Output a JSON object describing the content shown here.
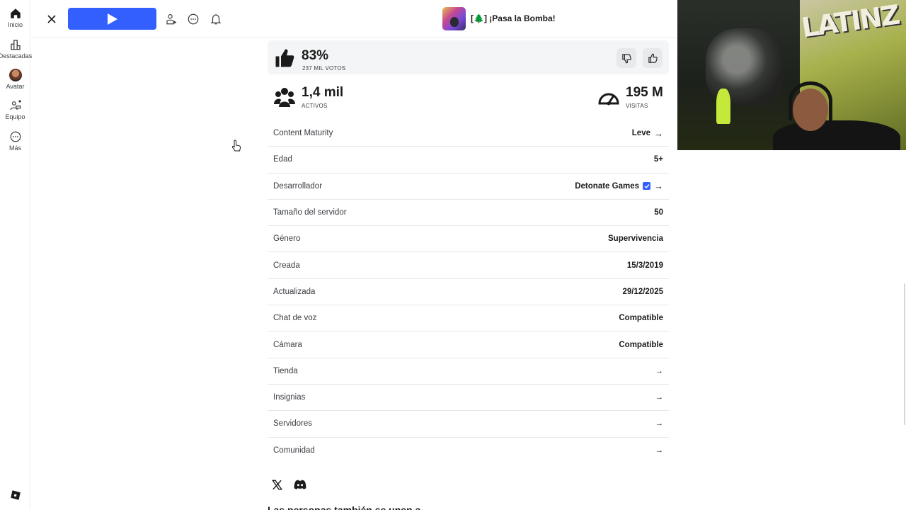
{
  "nav": {
    "items": [
      {
        "label": "Inicio",
        "icon": "home-icon"
      },
      {
        "label": "Destacadas",
        "icon": "charts-icon"
      },
      {
        "label": "Avatar",
        "icon": "avatar"
      },
      {
        "label": "Equipo",
        "icon": "party-icon"
      },
      {
        "label": "Más",
        "icon": "more-icon"
      }
    ]
  },
  "topbar": {
    "game_title": "[🌲] ¡Pasa la Bomba!",
    "play_color": "#335fff"
  },
  "rating": {
    "percent": "83%",
    "votes": "237 MIL VOTOS"
  },
  "stats": {
    "active_value": "1,4 mil",
    "active_label": "ACTIVOS",
    "visits_value": "195 M",
    "visits_label": "VISITAS"
  },
  "details": [
    {
      "key": "Content Maturity",
      "value": "Leve",
      "arrow": "→"
    },
    {
      "key": "Edad",
      "value": "5+"
    },
    {
      "key": "Desarrollador",
      "value": "Detonate Games",
      "verified": true,
      "arrow": "→"
    },
    {
      "key": "Tamaño del servidor",
      "value": "50"
    },
    {
      "key": "Género",
      "value": "Supervivencia"
    },
    {
      "key": "Creada",
      "value": "15/3/2019"
    },
    {
      "key": "Actualizada",
      "value": "29/12/2025"
    },
    {
      "key": "Chat de voz",
      "value": "Compatible"
    },
    {
      "key": "Cámara",
      "value": "Compatible"
    },
    {
      "key": "Tienda",
      "value": "",
      "arrow": "→"
    },
    {
      "key": "Insignias",
      "value": "",
      "arrow": "→"
    },
    {
      "key": "Servidores",
      "value": "",
      "arrow": "→"
    },
    {
      "key": "Comunidad",
      "value": "",
      "arrow": "→"
    }
  ],
  "socials": [
    "x-icon",
    "discord-icon"
  ],
  "section_heading": "Las personas también se unen a",
  "webcam": {
    "graffiti_text": "LATINZ"
  }
}
